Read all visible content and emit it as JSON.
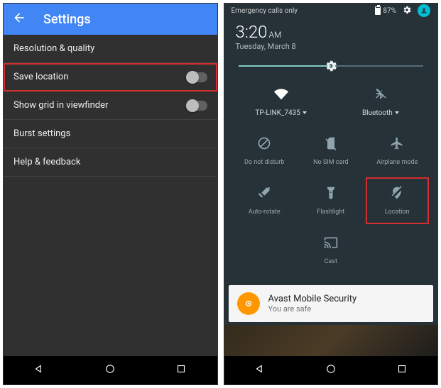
{
  "left": {
    "appbar_title": "Settings",
    "items": [
      {
        "label": "Resolution & quality",
        "toggle": null
      },
      {
        "label": "Save location",
        "toggle": false,
        "highlighted": true
      },
      {
        "label": "Show grid in viewfinder",
        "toggle": false
      },
      {
        "label": "Burst settings",
        "toggle": null
      },
      {
        "label": "Help & feedback",
        "toggle": null
      }
    ]
  },
  "right": {
    "statusbar": {
      "emergency": "Emergency calls only",
      "battery": "87%"
    },
    "time": "3:20",
    "ampm": "AM",
    "date": "Tuesday, March 8",
    "tiles": {
      "wifi_label": "TP-LINK_7435",
      "bluetooth_label": "Bluetooth",
      "dnd": "Do not disturb",
      "sim": "No SIM card",
      "airplane": "Airplane mode",
      "rotate": "Auto-rotate",
      "flash": "Flashlight",
      "location": "Location",
      "cast": "Cast"
    },
    "notification": {
      "title": "Avast Mobile Security",
      "body": "You are safe"
    }
  }
}
